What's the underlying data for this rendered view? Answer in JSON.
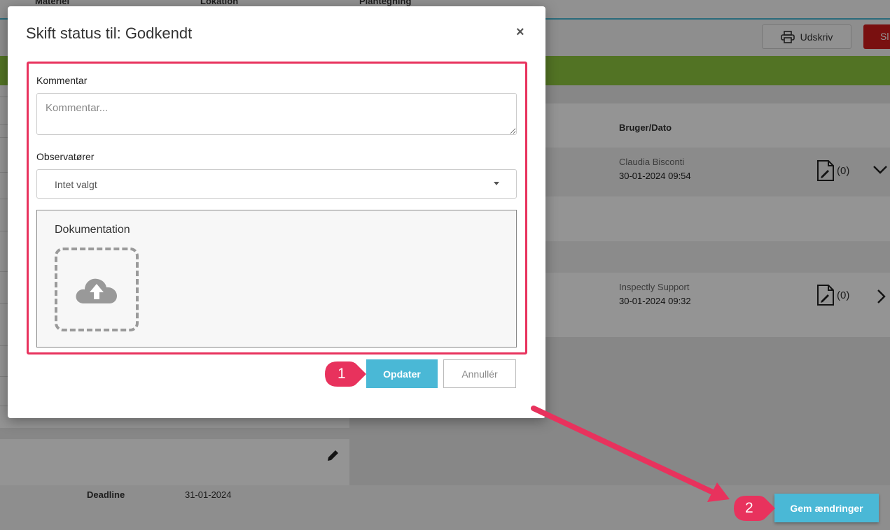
{
  "background": {
    "column_headers": [
      "Materiel",
      "Lokation",
      "Plantegning"
    ],
    "print_button": "Udskriv",
    "red_button": "Sl",
    "right_panel": {
      "header": "Bruger/Dato",
      "rows": [
        {
          "user": "Claudia Bisconti",
          "date": "30-01-2024 09:54",
          "count": "(0)",
          "chevron": "chevron-down-icon"
        },
        {
          "user": "Inspectly Support",
          "date": "30-01-2024 09:32",
          "count": "(0)",
          "chevron": "chevron-right-icon"
        }
      ]
    },
    "deadline_label": "Deadline",
    "deadline_value": "31-01-2024",
    "save_button": "Gem ændringer"
  },
  "modal": {
    "title": "Skift status til: Godkendt",
    "close": "×",
    "comment_label": "Kommentar",
    "comment_placeholder": "Kommentar...",
    "comment_value": "",
    "observers_label": "Observatører",
    "observers_value": "Intet valgt",
    "documentation_title": "Dokumentation",
    "update_button": "Opdater",
    "cancel_button": "Annullér"
  },
  "annotations": {
    "marker1": "1",
    "marker2": "2"
  },
  "colors": {
    "accent": "#4ab8d6",
    "highlight": "#e8325d",
    "green_bar": "#8ec63f",
    "danger": "#d01c1c"
  }
}
